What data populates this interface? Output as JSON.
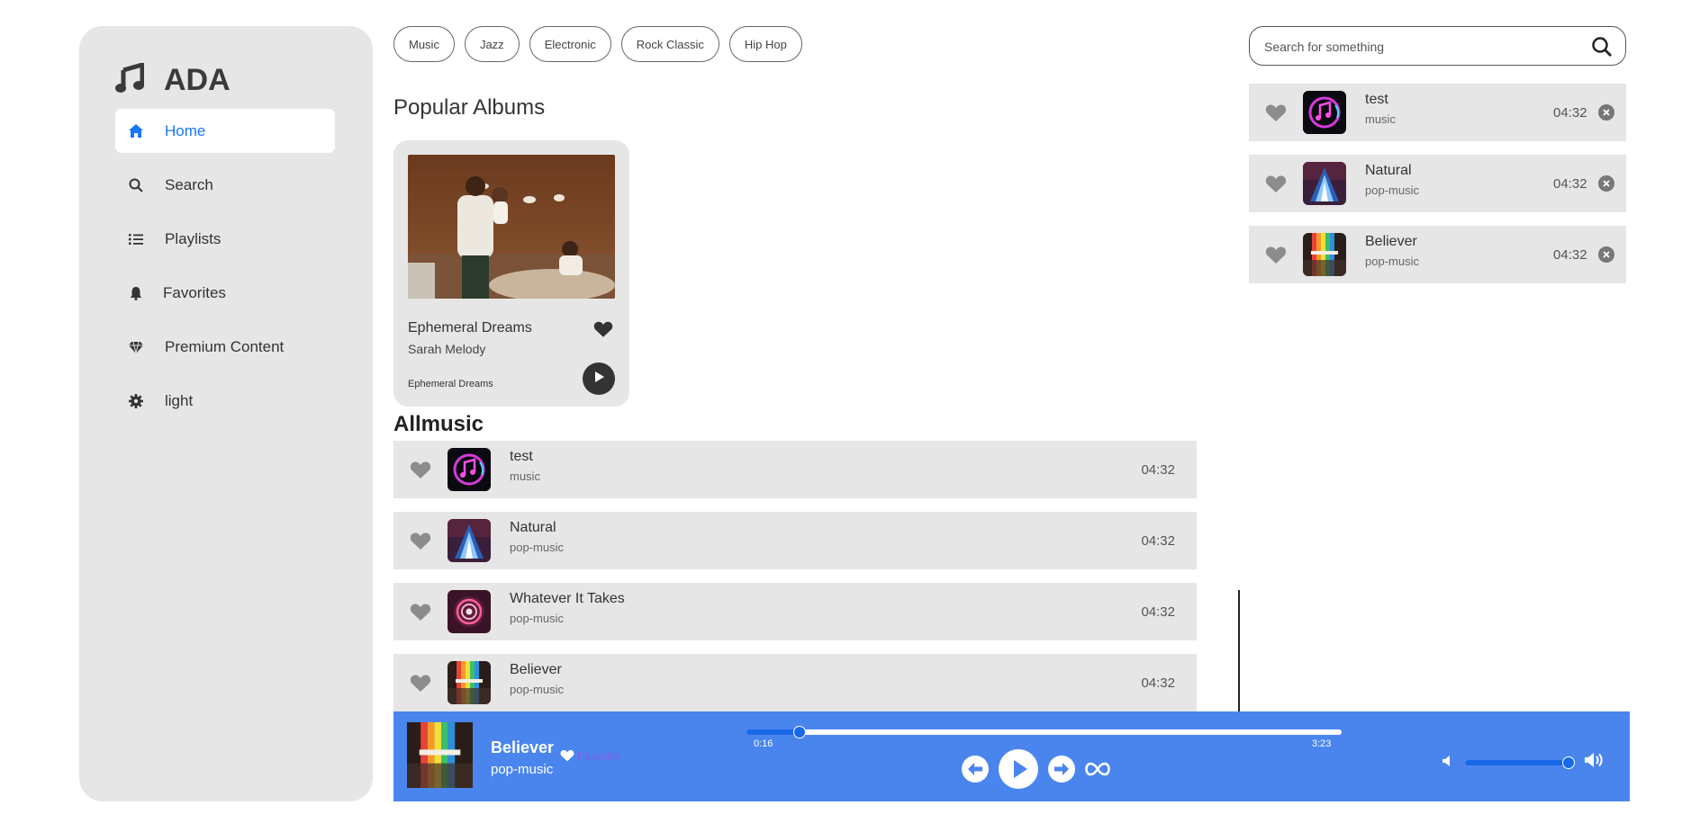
{
  "app": {
    "brand": "ADA",
    "brand_icon": "music-note-icon"
  },
  "sidebar": {
    "items": [
      {
        "label": "Home",
        "icon": "home-icon",
        "active": true
      },
      {
        "label": "Search",
        "icon": "search-icon"
      },
      {
        "label": "Playlists",
        "icon": "list-icon"
      },
      {
        "label": "Favorites",
        "icon": "bell-icon"
      },
      {
        "label": "Premium Content",
        "icon": "diamond-icon"
      },
      {
        "label": "light",
        "icon": "gear-icon"
      }
    ]
  },
  "genres": [
    "Music",
    "Jazz",
    "Electronic",
    "Rock Classic",
    "Hip Hop"
  ],
  "popular": {
    "title": "Popular Albums",
    "albums": [
      {
        "name": "Ephemeral Dreams",
        "artist": "Sarah Melody",
        "subtitle": "Ephemeral Dreams"
      }
    ]
  },
  "allmusic": {
    "title": "Allmusic",
    "tracks": [
      {
        "name": "test",
        "genre": "music",
        "duration": "04:32"
      },
      {
        "name": "Natural",
        "genre": "pop-music",
        "duration": "04:32"
      },
      {
        "name": "Whatever It Takes",
        "genre": "pop-music",
        "duration": "04:32"
      },
      {
        "name": "Believer",
        "genre": "pop-music",
        "duration": "04:32"
      }
    ]
  },
  "search": {
    "placeholder": "Search for something"
  },
  "queue": [
    {
      "name": "test",
      "genre": "music",
      "duration": "04:32"
    },
    {
      "name": "Natural",
      "genre": "pop-music",
      "duration": "04:32"
    },
    {
      "name": "Believer",
      "genre": "pop-music",
      "duration": "04:32"
    }
  ],
  "player": {
    "title": "Believer",
    "genre": "pop-music",
    "favorite_label": "Favorite",
    "current_time": "0:16",
    "total_time": "3:23",
    "progress": 0.09,
    "volume": 0.96,
    "accent_color": "#4a85ee"
  },
  "colors": {
    "panel": "#e6e6e6",
    "active_nav": "#1877f2"
  }
}
